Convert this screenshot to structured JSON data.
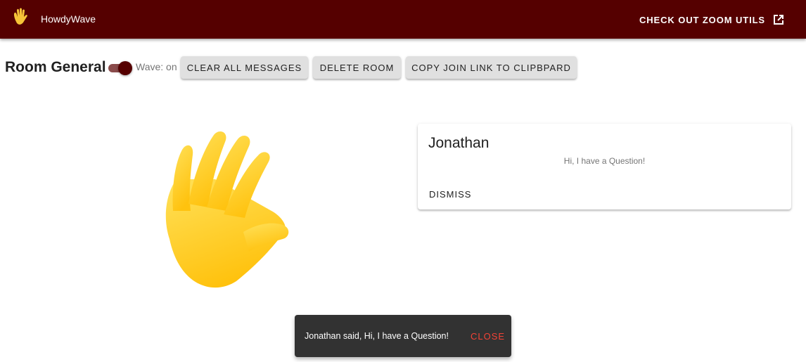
{
  "app": {
    "title": "HowdyWave",
    "zoom_link_label": "CHECK OUT ZOOM UTILS",
    "bar_color": "#550000"
  },
  "room": {
    "title": "Room General",
    "wave_toggle": {
      "label": "Wave: on",
      "checked": true
    },
    "buttons": {
      "clear": "CLEAR ALL MESSAGES",
      "delete": "DELETE ROOM",
      "copy": "COPY JOIN LINK TO CLIPBPARD"
    }
  },
  "messages": [
    {
      "name": "Jonathan",
      "text": "Hi, I have a Question!",
      "dismiss_label": "DISMISS"
    }
  ],
  "snackbar": {
    "text": "Jonathan said, Hi, I have a Question!",
    "close_label": "CLOSE",
    "close_color": "#f44336"
  },
  "icons": {
    "logo": "waving-hand-icon",
    "external": "open-in-new-icon",
    "illustration": "waving-hand-illustration"
  }
}
